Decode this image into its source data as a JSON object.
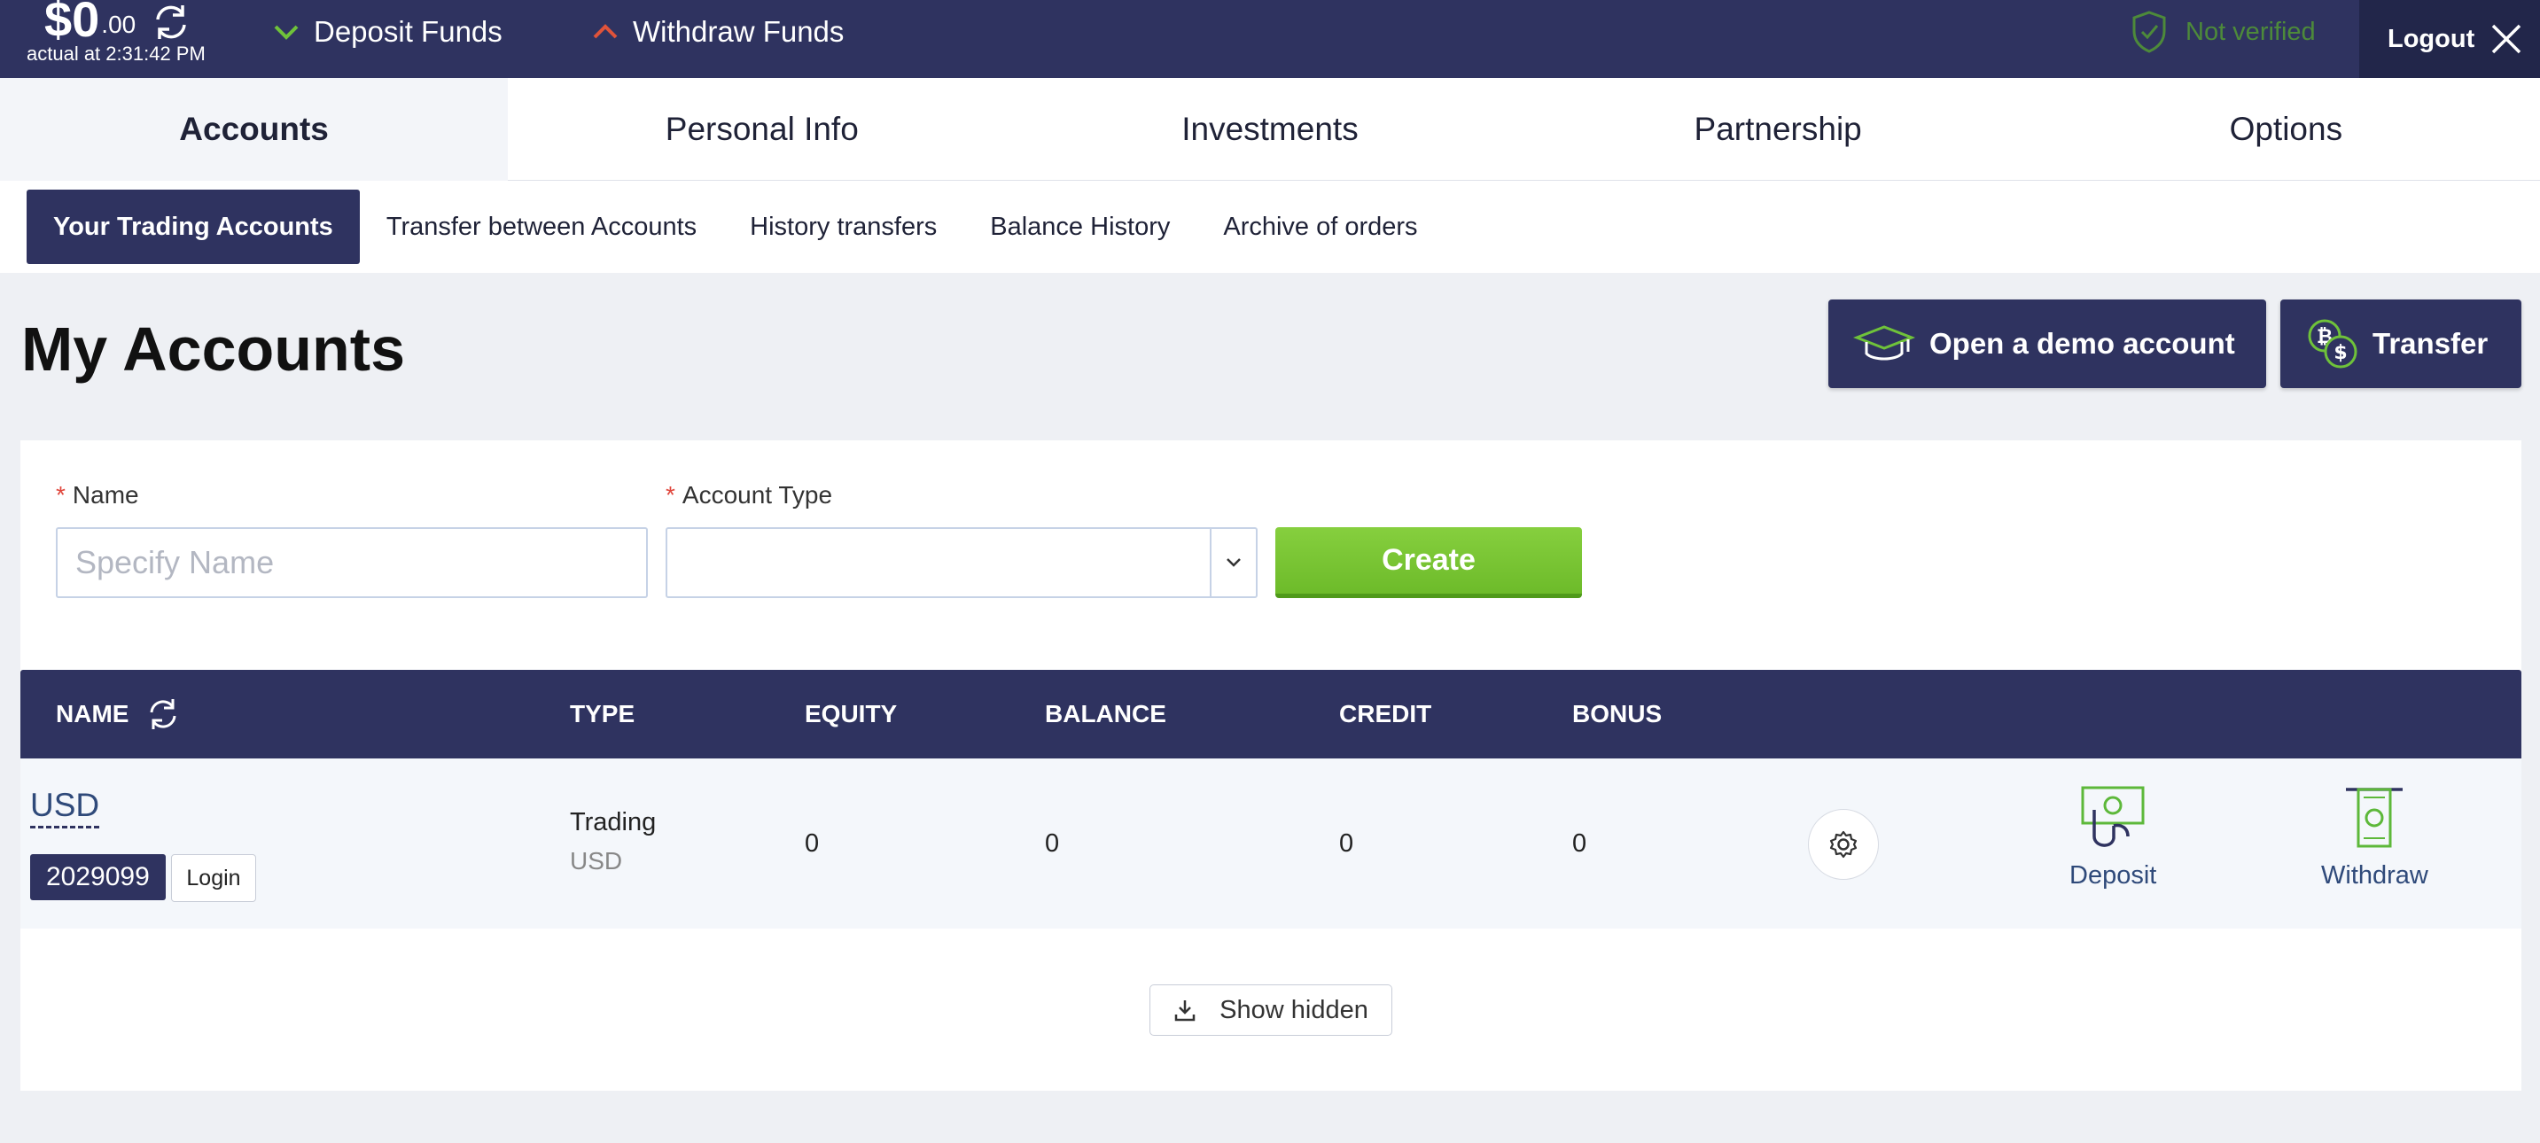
{
  "topbar": {
    "balance_main": "$0",
    "balance_cents": ".00",
    "actual_text": "actual at 2:31:42 PM",
    "deposit_funds": "Deposit Funds",
    "withdraw_funds": "Withdraw Funds",
    "verification_status": "Not verified",
    "logout": "Logout"
  },
  "main_tabs": [
    {
      "label": "Accounts",
      "active": true
    },
    {
      "label": "Personal Info",
      "active": false
    },
    {
      "label": "Investments",
      "active": false
    },
    {
      "label": "Partnership",
      "active": false
    },
    {
      "label": "Options",
      "active": false
    }
  ],
  "sub_tabs": [
    {
      "label": "Your Trading Accounts",
      "active": true
    },
    {
      "label": "Transfer between Accounts",
      "active": false
    },
    {
      "label": "History transfers",
      "active": false
    },
    {
      "label": "Balance History",
      "active": false
    },
    {
      "label": "Archive of orders",
      "active": false
    }
  ],
  "page": {
    "title": "My Accounts",
    "demo_button": "Open a demo account",
    "transfer_button": "Transfer"
  },
  "form": {
    "name_label": "Name",
    "name_placeholder": "Specify Name",
    "name_value": "",
    "type_label": "Account Type",
    "type_value": "",
    "required_mark": "*",
    "create_button": "Create"
  },
  "table": {
    "headers": {
      "name": "NAME",
      "type": "TYPE",
      "equity": "EQUITY",
      "balance": "BALANCE",
      "credit": "CREDIT",
      "bonus": "BONUS"
    },
    "rows": [
      {
        "name": "USD",
        "number": "2029099",
        "login": "Login",
        "type": "Trading",
        "type_sub": "USD",
        "equity": "0",
        "balance": "0",
        "credit": "0",
        "bonus": "0",
        "deposit": "Deposit",
        "withdraw": "Withdraw"
      }
    ],
    "show_hidden": "Show hidden"
  },
  "colors": {
    "navy": "#2f3360",
    "green": "#6dbb2a",
    "link": "#2f4a7a",
    "required": "#e0463c"
  }
}
